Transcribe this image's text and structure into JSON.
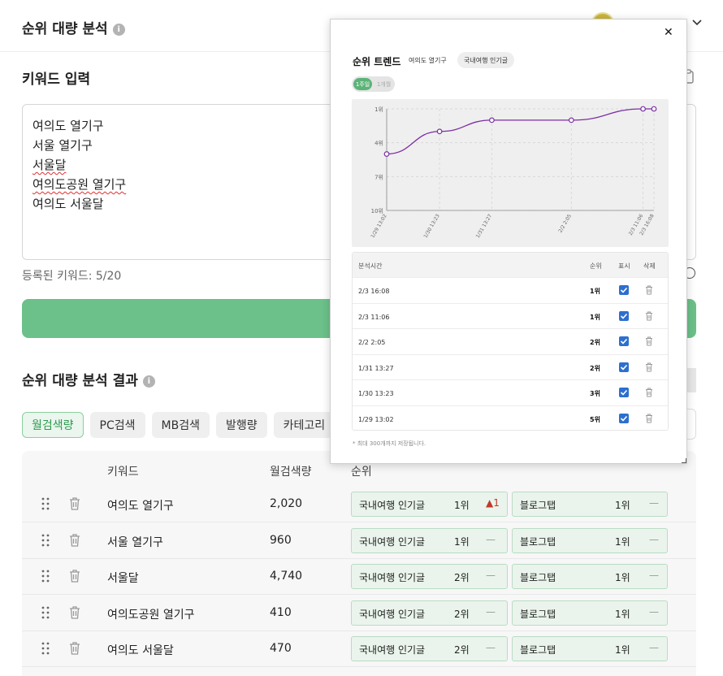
{
  "header": {
    "title": "순위 대량 분석"
  },
  "input_section": {
    "title": "키워드 입력",
    "keywords": [
      "여의도 열기구",
      "서울 열기구",
      "서울달",
      "여의도공원 열기구",
      "여의도 서울달"
    ],
    "count_label": "등록된 키워드: 5/20"
  },
  "results": {
    "title": "순위 대량 분석 결과",
    "filters": [
      "월검색량",
      "PC검색",
      "MB검색",
      "발행량",
      "카테고리"
    ],
    "columns": {
      "keyword": "키워드",
      "volume": "월검색량",
      "rank": "순위"
    },
    "rows": [
      {
        "keyword": "여의도 열기구",
        "volume": "2,020",
        "r1_label": "국내여행 인기글",
        "r1_rank": "1위",
        "r1_change": "▲1",
        "r2_label": "블로그탭",
        "r2_rank": "1위",
        "r2_change": "—"
      },
      {
        "keyword": "서울 열기구",
        "volume": "960",
        "r1_label": "국내여행 인기글",
        "r1_rank": "1위",
        "r1_change": "—",
        "r2_label": "블로그탭",
        "r2_rank": "1위",
        "r2_change": "—"
      },
      {
        "keyword": "서울달",
        "volume": "4,740",
        "r1_label": "국내여행 인기글",
        "r1_rank": "2위",
        "r1_change": "—",
        "r2_label": "블로그탭",
        "r2_rank": "1위",
        "r2_change": "—"
      },
      {
        "keyword": "여의도공원 열기구",
        "volume": "410",
        "r1_label": "국내여행 인기글",
        "r1_rank": "2위",
        "r1_change": "—",
        "r2_label": "블로그탭",
        "r2_rank": "1위",
        "r2_change": "—"
      },
      {
        "keyword": "여의도 서울달",
        "volume": "470",
        "r1_label": "국내여행 인기글",
        "r1_rank": "2위",
        "r1_change": "—",
        "r2_label": "블로그탭",
        "r2_rank": "1위",
        "r2_change": "—"
      }
    ]
  },
  "popup": {
    "title": "순위 트렌드",
    "keyword": "여의도 열기구",
    "category": "국내여행 인기글",
    "toggle_on": "1주일",
    "toggle_off": "1개월",
    "history_header": {
      "time": "분석시간",
      "rank": "순위",
      "show": "표시",
      "delete": "삭제"
    },
    "history": [
      {
        "time": "2/3 16:08",
        "rank": "1위"
      },
      {
        "time": "2/3 11:06",
        "rank": "1위"
      },
      {
        "time": "2/2 2:05",
        "rank": "2위"
      },
      {
        "time": "1/31 13:27",
        "rank": "2위"
      },
      {
        "time": "1/30 13:23",
        "rank": "3위"
      },
      {
        "time": "1/29 13:02",
        "rank": "5위"
      }
    ],
    "note": "* 최대 300개까지 저장됩니다."
  },
  "chart_data": {
    "type": "line",
    "x": [
      "1/29 13:02",
      "1/30 13:23",
      "1/31 13:27",
      "2/2 2:05",
      "2/3 11:06",
      "2/3 16:08"
    ],
    "y_tick_labels": [
      "1위",
      "4위",
      "7위",
      "10위"
    ],
    "ylim": [
      10,
      1
    ],
    "series": [
      {
        "values": [
          5,
          3,
          2,
          2,
          1,
          1
        ]
      }
    ],
    "line_color": "#7b2fa3",
    "grid": true
  }
}
